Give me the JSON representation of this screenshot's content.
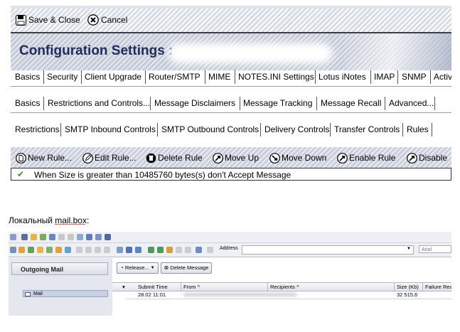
{
  "notes_window": {
    "toolbar": {
      "save_close": "Save & Close",
      "cancel": "Cancel"
    },
    "title": "Configuration Settings :",
    "tabs_primary": [
      "Basics",
      "Security",
      "Client Upgrade",
      "Router/SMTP",
      "MIME",
      "NOTES.INI Settings",
      "Lotus iNotes",
      "IMAP",
      "SNMP",
      "Activ"
    ],
    "tabs_secondary": [
      "Basics",
      "Restrictions and Controls...",
      "Message Disclaimers",
      "Message Tracking",
      "Message Recall",
      "Advanced..."
    ],
    "tabs_tertiary": [
      "Restrictions",
      "SMTP Inbound Controls",
      "SMTP Outbound Controls",
      "Delivery Controls",
      "Transfer Controls",
      "Rules"
    ],
    "actions": [
      "New Rule...",
      "Edit Rule...",
      "Delete Rule",
      "Move Up",
      "Move Down",
      "Enable Rule",
      "Disable"
    ],
    "rule_text": "When Size is greater than 10485760 bytes(s) don't Accept Message",
    "rule_status_icon": "checkmark-icon",
    "check_color": "#2f9a2f",
    "banner_title_color": "#1f2c5a"
  },
  "caption": {
    "prefix": "Локальный ",
    "underlined": "mail.box",
    "suffix": ":"
  },
  "mailbox_window": {
    "address_label": "Address",
    "font_field_placeholder": "Arial",
    "nav_title": "Outgoing Mail",
    "nav_item": "Mail",
    "actions": [
      "Release...",
      "Delete Message"
    ],
    "columns": [
      "Submit Time",
      "From ^",
      "Recipients ^",
      "Size (Kb)",
      "Failure Rea"
    ],
    "rows": [
      {
        "submit_time": "28.02 11:01",
        "size_kb": "32 515,6"
      }
    ]
  }
}
